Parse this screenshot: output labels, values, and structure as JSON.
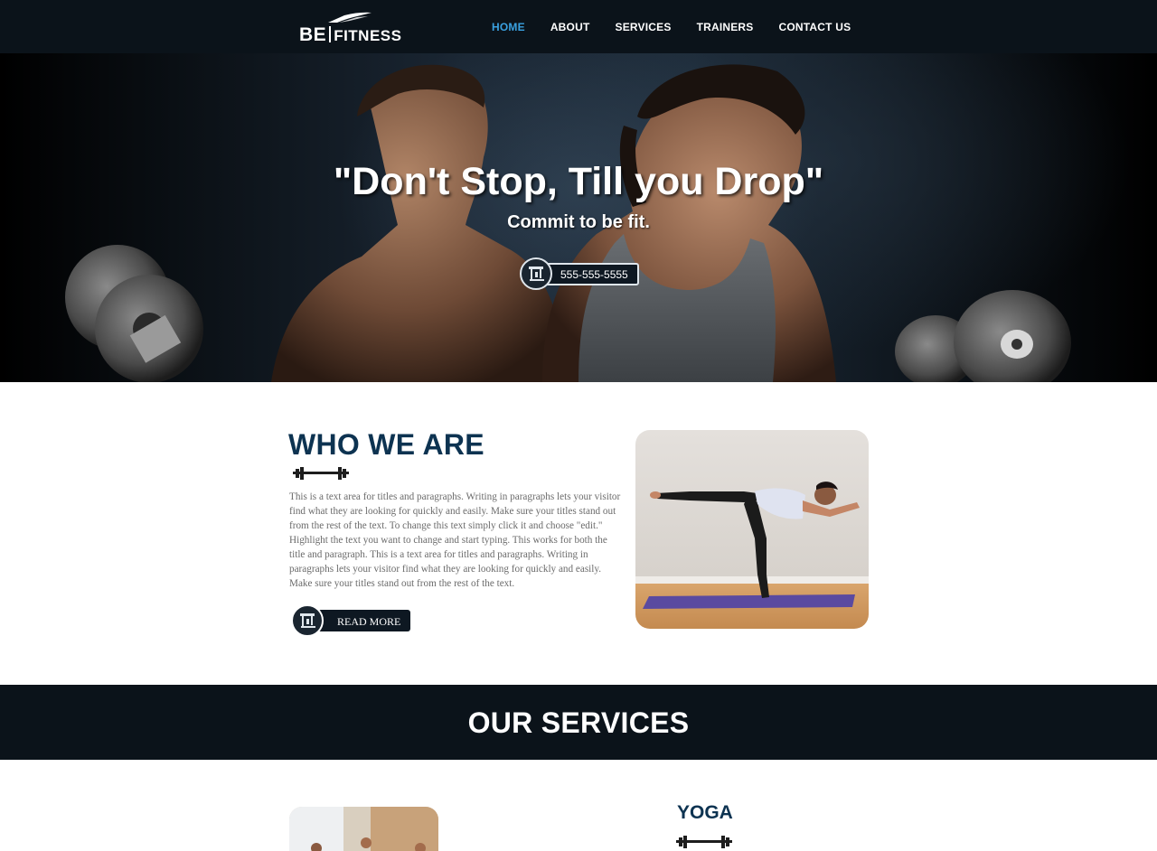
{
  "logo": {
    "be": "BE",
    "fitness": "FITNESS"
  },
  "nav": {
    "items": [
      {
        "label": "HOME",
        "active": true
      },
      {
        "label": "ABOUT",
        "active": false
      },
      {
        "label": "SERVICES",
        "active": false
      },
      {
        "label": "TRAINERS",
        "active": false
      },
      {
        "label": "CONTACT US",
        "active": false
      }
    ]
  },
  "hero": {
    "title": "\"Don't Stop, Till you Drop\"",
    "subtitle": "Commit to be fit.",
    "phone": "555-555-5555"
  },
  "who": {
    "title": "WHO WE ARE",
    "text": "This is a text area for titles and paragraphs. Writing in paragraphs lets your visitor find what they are looking for quickly and easily. Make sure your titles stand out from the rest of the text. To change this text simply click it and choose \"edit.\" Highlight the text you want to change and start typing. This works for both the title and paragraph. This is a text area for titles and paragraphs. Writing in paragraphs lets your visitor find what they are looking for quickly and easily. Make sure your titles stand out from the rest of the text.",
    "button": "READ MORE"
  },
  "services": {
    "title": "OUR SERVICES",
    "first_heading": "YOGA"
  },
  "colors": {
    "navy": "#0b131a",
    "heading_blue": "#0d3351",
    "nav_active": "#3aa1e0"
  },
  "icons": [
    "phone-treadmill-icon",
    "dumbbell-divider-icon",
    "treadmill-icon"
  ]
}
